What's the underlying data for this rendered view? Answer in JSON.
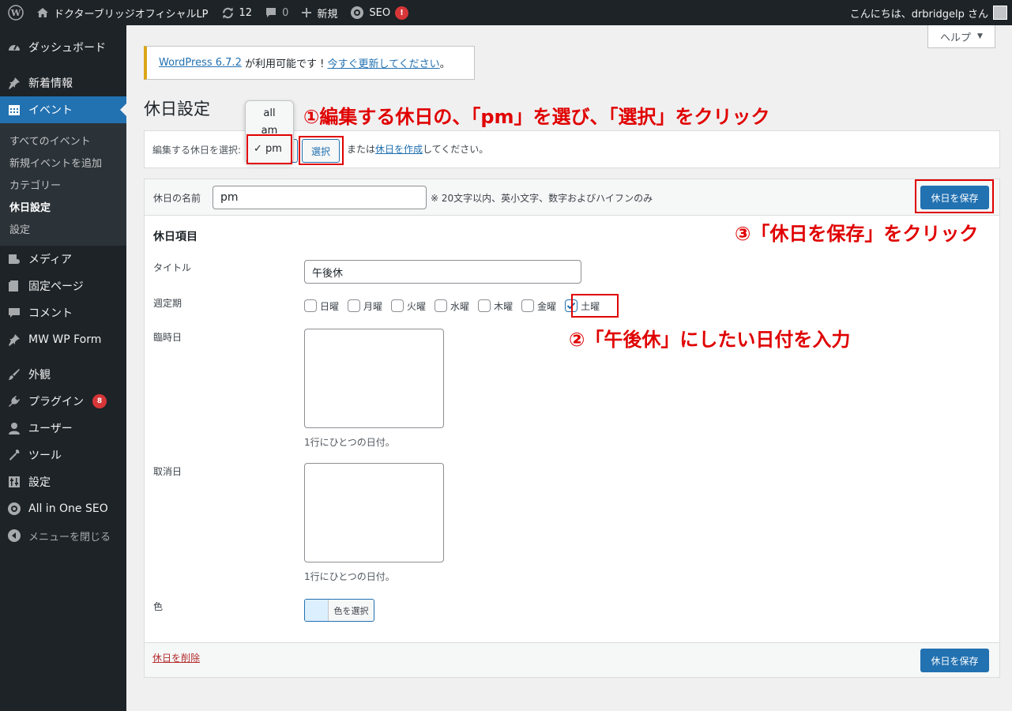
{
  "adminbar": {
    "site_name": "ドクターブリッジオフィシャルLP",
    "updates_count": "12",
    "comments_count": "0",
    "new_label": "新規",
    "seo_label": "SEO",
    "seo_badge": "!",
    "greeting": "こんにちは、drbridgelp さん"
  },
  "sidebar": {
    "dashboard": "ダッシュボード",
    "news": "新着情報",
    "event": "イベント",
    "submenu": [
      "すべてのイベント",
      "新規イベントを追加",
      "カテゴリー",
      "休日設定",
      "設定"
    ],
    "media": "メディア",
    "pages": "固定ページ",
    "comments": "コメント",
    "mwform": "MW WP Form",
    "appearance": "外観",
    "plugins": "プラグイン",
    "plugins_badge": "8",
    "users": "ユーザー",
    "tools": "ツール",
    "settings": "設定",
    "aioseo": "All in One SEO",
    "collapse": "メニューを閉じる"
  },
  "help": {
    "label": "ヘルプ"
  },
  "notice": {
    "version_link": "WordPress 6.7.2",
    "middle": " が利用可能です ! ",
    "update_link": "今すぐ更新してください",
    "end": "。"
  },
  "page": {
    "title": "休日設定"
  },
  "selector": {
    "label": "編集する休日を選択:",
    "options": [
      "all",
      "am",
      "pm"
    ],
    "selected": "pm",
    "select_button": "選択",
    "or_text": "または",
    "create_link": "休日を作成",
    "after_text": "してください。"
  },
  "form": {
    "name_label": "休日の名前",
    "name_value": "pm",
    "name_hint": "※ 20文字以内、英小文字、数字およびハイフンのみ",
    "save_button": "休日を保存",
    "section_title": "休日項目",
    "title_label": "タイトル",
    "title_value": "午後休",
    "weekly_label": "週定期",
    "days": [
      {
        "label": "日曜",
        "checked": false
      },
      {
        "label": "月曜",
        "checked": false
      },
      {
        "label": "火曜",
        "checked": false
      },
      {
        "label": "水曜",
        "checked": false
      },
      {
        "label": "木曜",
        "checked": false
      },
      {
        "label": "金曜",
        "checked": false
      },
      {
        "label": "土曜",
        "checked": true
      }
    ],
    "temporary_label": "臨時日",
    "temporary_hint": "1行にひとつの日付。",
    "cancel_label": "取消日",
    "cancel_hint": "1行にひとつの日付。",
    "color_label": "色",
    "color_button": "色を選択",
    "delete_link": "休日を削除",
    "save_button_bottom": "休日を保存"
  },
  "annotations": {
    "step1": "①編集する休日の、「pm」を選び、「選択」をクリック",
    "step2": "②「午後休」にしたい日付を入力",
    "step3": "③「休日を保存」をクリック"
  },
  "colors": {
    "admin_bar": "#1d2327",
    "accent": "#2271b1",
    "annotation": "#e00000",
    "notice_border": "#dba617"
  }
}
